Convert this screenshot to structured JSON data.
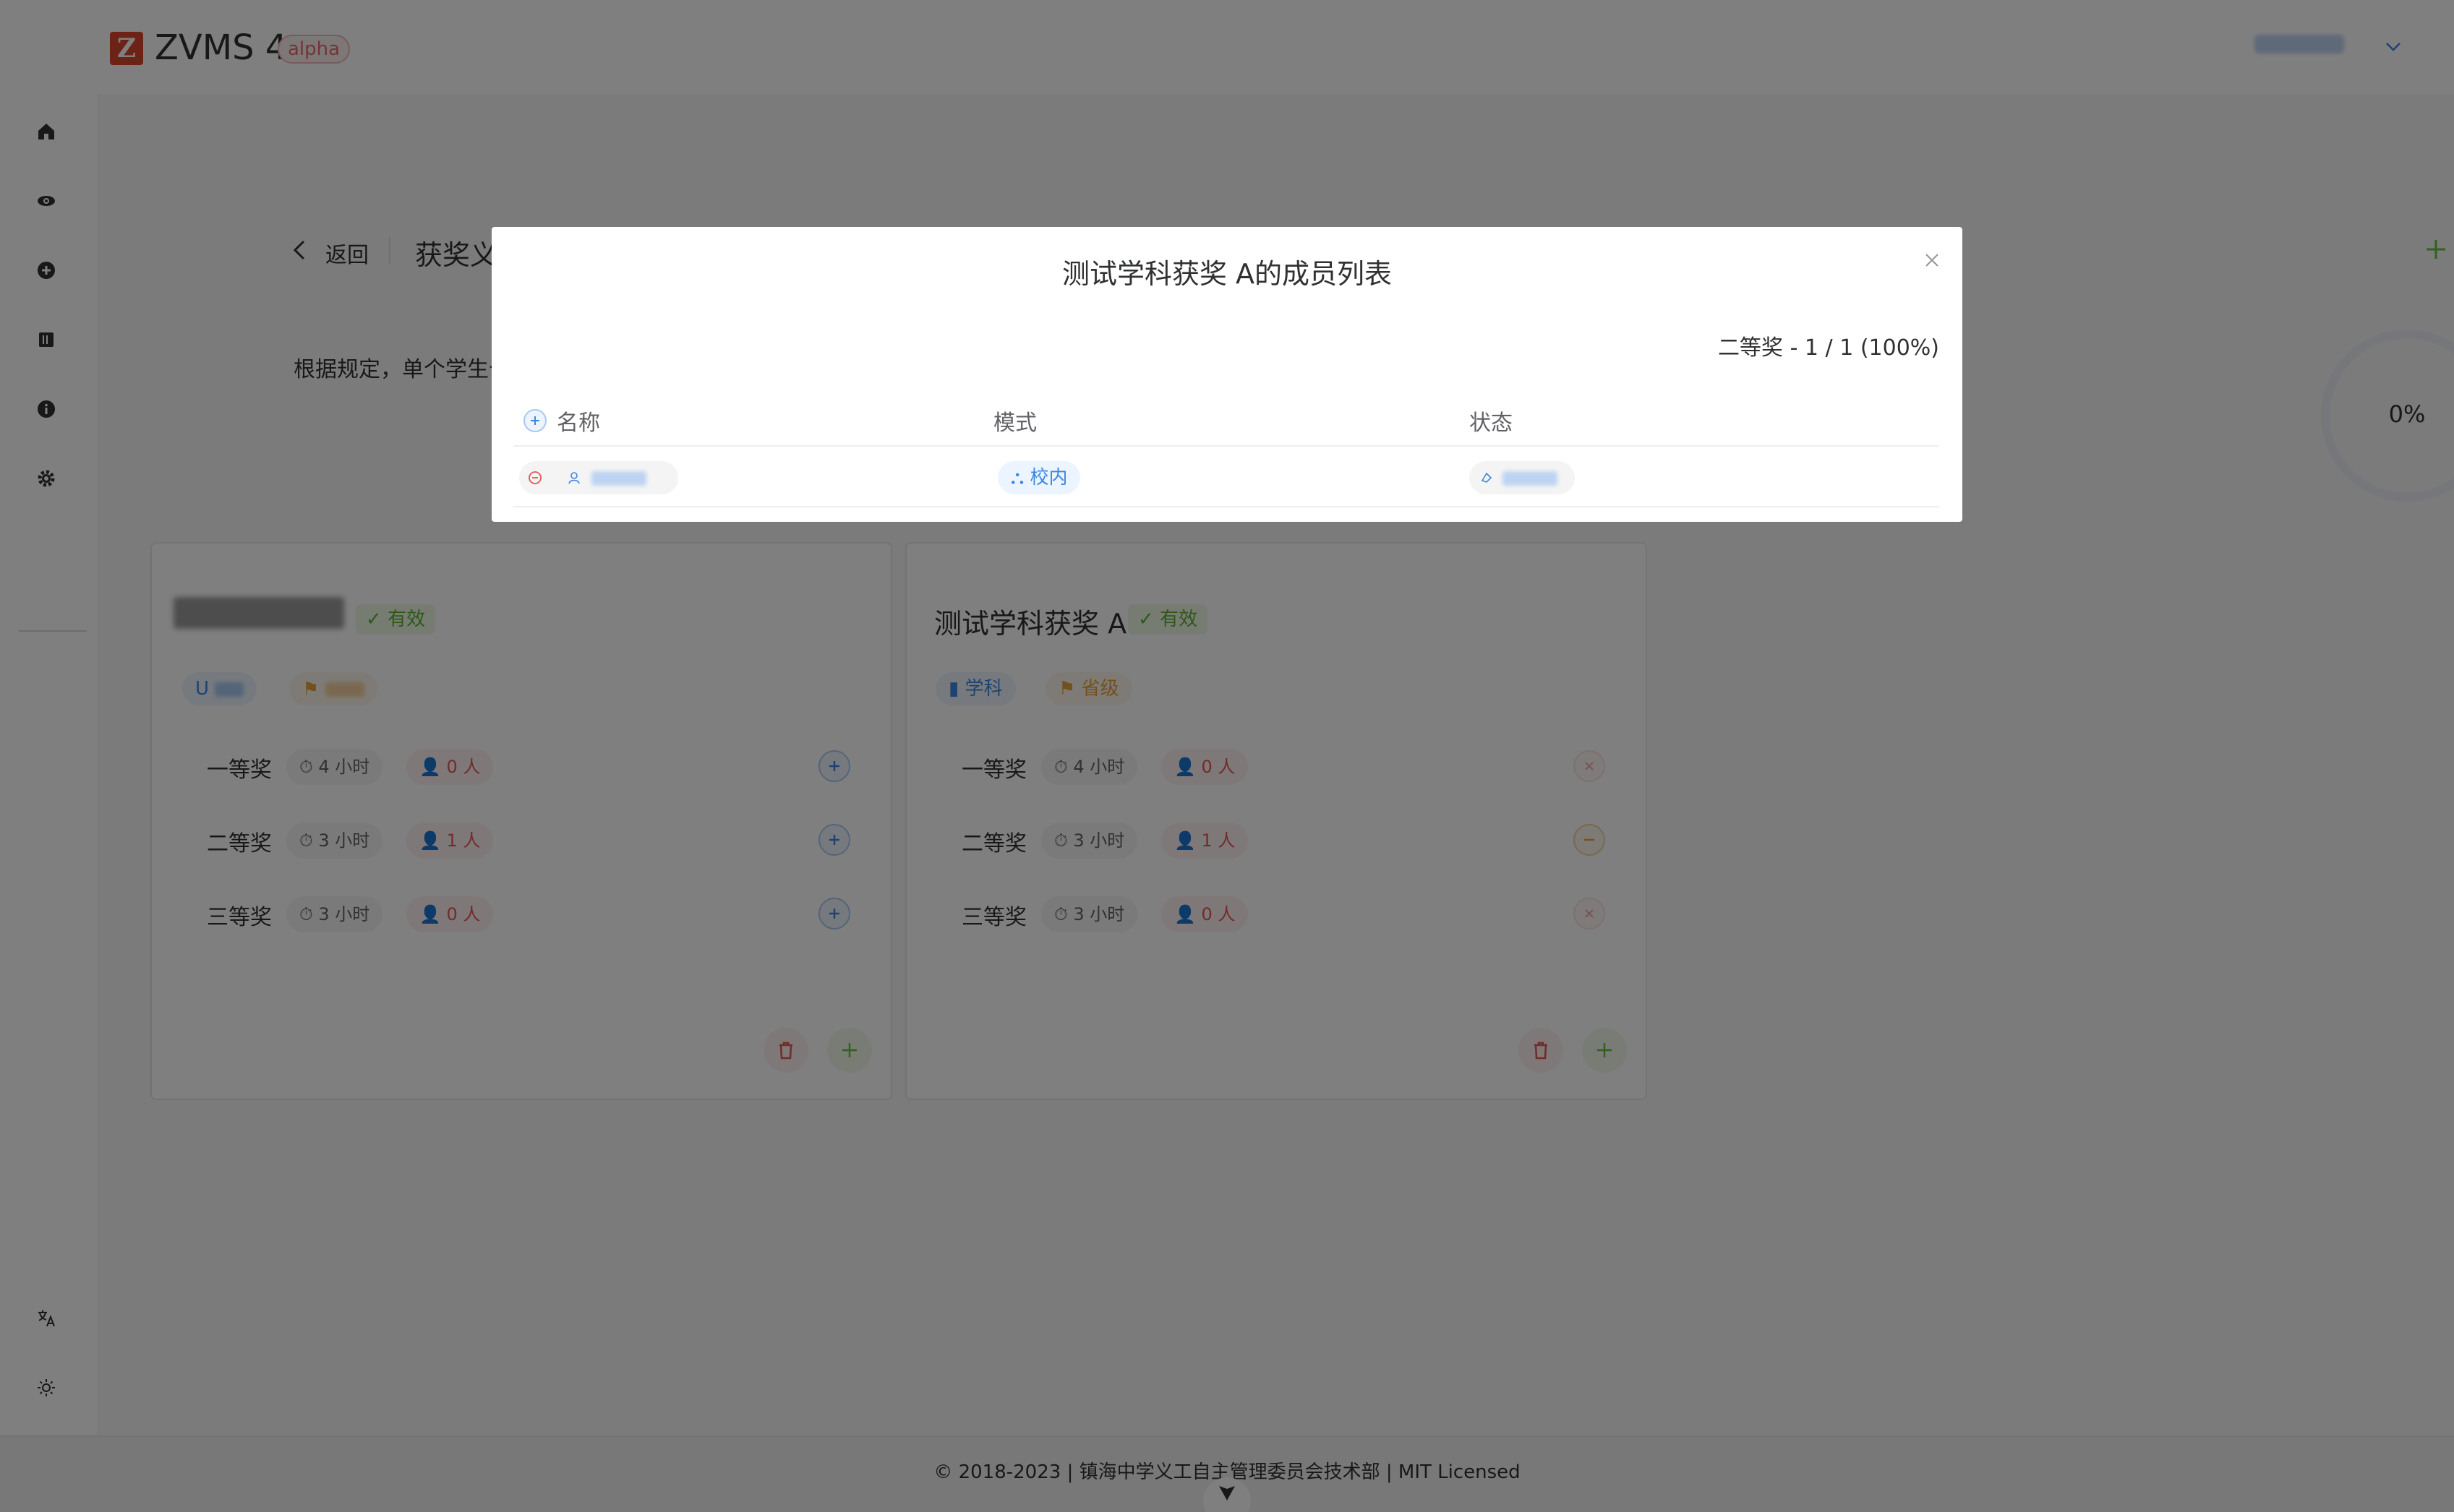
{
  "header": {
    "logo_letter": "Z",
    "app_title": "ZVMS 4",
    "badge": "alpha"
  },
  "sidebar": {
    "items": [
      {
        "icon": "home-icon"
      },
      {
        "icon": "eye-icon"
      },
      {
        "icon": "plus-circle-icon"
      },
      {
        "icon": "book-icon"
      },
      {
        "icon": "info-icon"
      },
      {
        "icon": "gear-icon"
      }
    ],
    "bottom": [
      {
        "icon": "translate-icon"
      },
      {
        "icon": "sun-icon"
      }
    ]
  },
  "page": {
    "back_label": "返回",
    "title": "获奖义工",
    "rule_text": "根据规定，单个学生个人获奖类",
    "progress": "0%"
  },
  "cards": [
    {
      "name": "",
      "valid": "有效",
      "tags": [
        {
          "label": "U",
          "color": "#3d87e0"
        },
        {
          "label": "",
          "color": "#e6a23c"
        }
      ],
      "prizes": [
        {
          "name": "一等奖",
          "hours": "4 小时",
          "people": "0 人",
          "action": "add"
        },
        {
          "name": "二等奖",
          "hours": "3 小时",
          "people": "1 人",
          "action": "add"
        },
        {
          "name": "三等奖",
          "hours": "3 小时",
          "people": "0 人",
          "action": "add"
        }
      ]
    },
    {
      "name": "测试学科获奖 A",
      "valid": "有效",
      "tags": [
        {
          "label": "学科",
          "color": "#3d87e0"
        },
        {
          "label": "省级",
          "color": "#e6a23c"
        }
      ],
      "prizes": [
        {
          "name": "一等奖",
          "hours": "4 小时",
          "people": "0 人",
          "action": "disabled"
        },
        {
          "name": "二等奖",
          "hours": "3 小时",
          "people": "1 人",
          "action": "remove"
        },
        {
          "name": "三等奖",
          "hours": "3 小时",
          "people": "0 人",
          "action": "disabled"
        }
      ]
    }
  ],
  "footer": {
    "text": "© 2018-2023 | 镇海中学义工自主管理委员会技术部 | MIT Licensed"
  },
  "modal": {
    "title": "测试学科获奖 A的成员列表",
    "summary": "二等奖 - 1 / 1 (100%)",
    "columns": [
      "名称",
      "模式",
      "状态"
    ],
    "rows": [
      {
        "name": "",
        "mode": "校内",
        "status": ""
      }
    ]
  },
  "colors": {
    "accent_blue": "#3d87e0",
    "danger_red": "#e45656",
    "success_green": "#5cb131",
    "warning_orange": "#e6a23c",
    "logo_red": "#d8452b"
  }
}
